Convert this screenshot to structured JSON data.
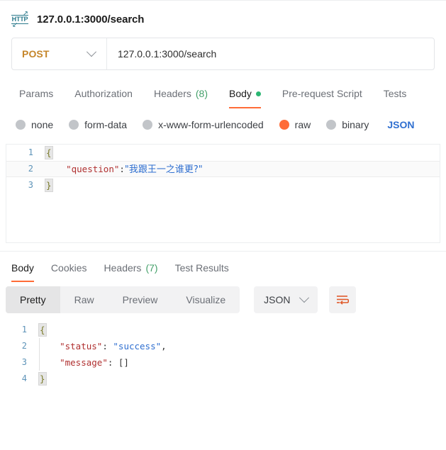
{
  "request": {
    "protocol_icon": "http-icon",
    "title": "127.0.0.1:3000/search",
    "method": "POST",
    "url": "127.0.0.1:3000/search",
    "tabs": [
      {
        "label": "Params",
        "active": false
      },
      {
        "label": "Authorization",
        "active": false
      },
      {
        "label": "Headers",
        "count": "(8)",
        "active": false
      },
      {
        "label": "Body",
        "active": true,
        "dot": true
      },
      {
        "label": "Pre-request Script",
        "active": false
      },
      {
        "label": "Tests",
        "active": false
      }
    ],
    "body_types": [
      {
        "label": "none",
        "selected": false
      },
      {
        "label": "form-data",
        "selected": false
      },
      {
        "label": "x-www-form-urlencoded",
        "selected": false
      },
      {
        "label": "raw",
        "selected": true
      },
      {
        "label": "binary",
        "selected": false
      }
    ],
    "raw_format": "JSON",
    "body_lines": [
      {
        "no": "1",
        "open_brace": "{",
        "highlighted": false
      },
      {
        "no": "2",
        "key": "\"question\"",
        "colon": ":",
        "value": "\"我跟王一之谁更?\"",
        "highlighted": true
      },
      {
        "no": "3",
        "close_brace": "}",
        "highlighted": false
      }
    ]
  },
  "response": {
    "tabs": [
      {
        "label": "Body",
        "active": true
      },
      {
        "label": "Cookies",
        "active": false
      },
      {
        "label": "Headers",
        "count": "(7)",
        "active": false
      },
      {
        "label": "Test Results",
        "active": false
      }
    ],
    "view_modes": [
      {
        "label": "Pretty",
        "active": true
      },
      {
        "label": "Raw",
        "active": false
      },
      {
        "label": "Preview",
        "active": false
      },
      {
        "label": "Visualize",
        "active": false
      }
    ],
    "format": "JSON",
    "wrap_icon": "wrap-lines-icon",
    "body_lines": [
      {
        "no": "1",
        "open_brace": "{"
      },
      {
        "no": "2",
        "key": "\"status\"",
        "colon": ": ",
        "value": "\"success\"",
        "tail": ","
      },
      {
        "no": "3",
        "key": "\"message\"",
        "colon": ": ",
        "value": "[]"
      },
      {
        "no": "4",
        "close_brace": "}"
      }
    ]
  },
  "colors": {
    "accent": "#ff6c37",
    "method": "#c5862b",
    "json_blue": "#2f6fd0",
    "count_green": "#44a06a",
    "dot_green": "#2bb673",
    "http_icon": "#2b7a8c"
  }
}
